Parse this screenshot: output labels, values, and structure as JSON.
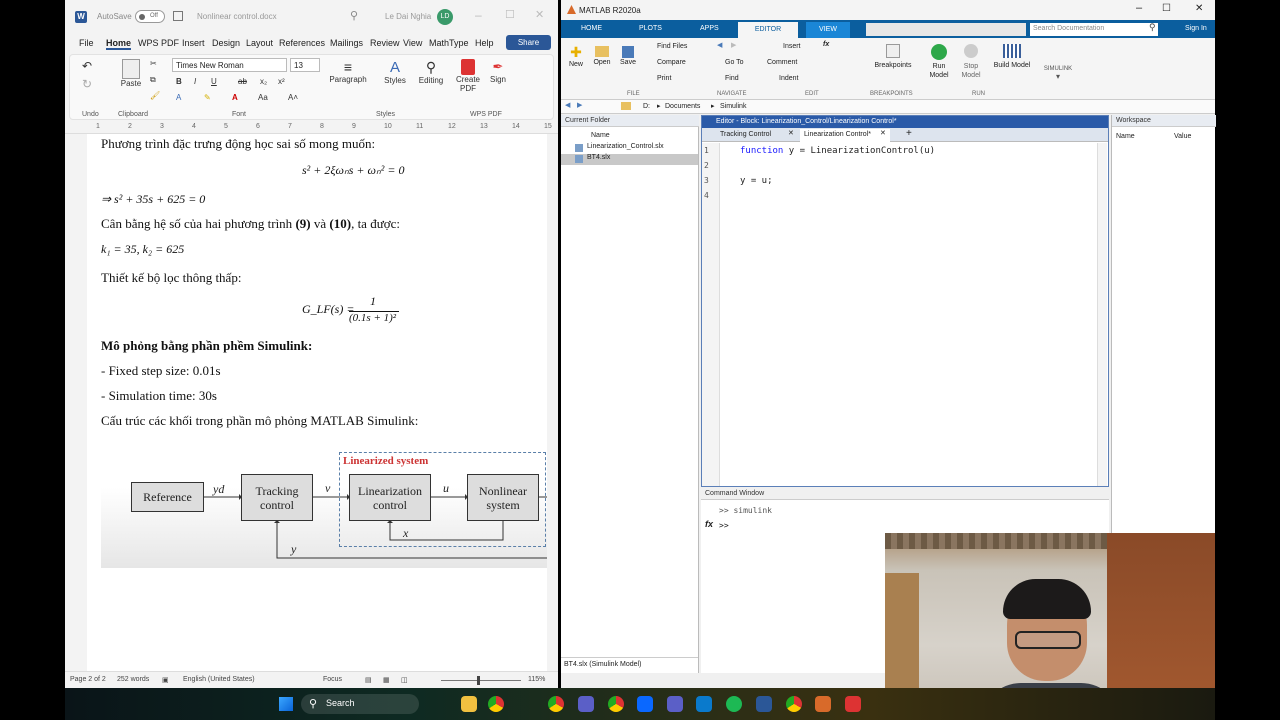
{
  "word": {
    "autosave_label": "AutoSave",
    "autosave_state": "Off",
    "doc_title": "Nonlinear control.docx",
    "user_name": "Le Dai Nghia",
    "user_initials": "LD",
    "tabs": [
      "File",
      "Home",
      "WPS PDF",
      "Insert",
      "Design",
      "Layout",
      "References",
      "Mailings",
      "Review",
      "View",
      "MathType",
      "Help"
    ],
    "share_label": "Share",
    "font_name": "Times New Roman",
    "font_size": "13",
    "groups": {
      "undo": "Undo",
      "clipboard": "Clipboard",
      "font": "Font",
      "styles": "Styles",
      "wps": "WPS PDF"
    },
    "buttons": {
      "paste": "Paste",
      "paragraph": "Paragraph",
      "styles": "Styles",
      "editing": "Editing",
      "create_pdf": "Create PDF",
      "sign": "Sign"
    },
    "ruler_numbers": [
      "1",
      "2",
      "3",
      "4",
      "5",
      "6",
      "7",
      "8",
      "9",
      "10",
      "11",
      "12",
      "13",
      "14",
      "15"
    ],
    "doc": {
      "line1": "Phương trình đặc trưng động học sai số mong muốn:",
      "eq1": "s² + 2ξωₙs + ωₙ² = 0",
      "eq2": "⇒ s² + 35s + 625 = 0",
      "line2_a": "Cân bằng hệ số của hai phương trình ",
      "line2_b": "(9)",
      "line2_c": " và ",
      "line2_d": "(10)",
      "line2_e": ", ta được:",
      "eq3": "k₁ = 35, k₂ = 625",
      "line3": "Thiết kế bộ lọc thông thấp:",
      "eq4_lhs": "G_LF(s) =",
      "eq4_num": "1",
      "eq4_den": "(0.1s + 1)²",
      "line4": "Mô phỏng bằng phần phềm Simulink:",
      "line5": "- Fixed step size: 0.01s",
      "line6": "- Simulation time: 30s",
      "line7": "Cấu trúc các khối trong phần mô phỏng MATLAB Simulink:"
    },
    "diagram": {
      "group_label": "Linearized system",
      "reference": "Reference",
      "yd": "yd",
      "tracking": "Tracking control",
      "v": "v",
      "lincontrol": "Linearization control",
      "u": "u",
      "nonlinear": "Nonlinear system",
      "x": "x",
      "y": "y"
    },
    "status": {
      "page": "Page 2 of 2",
      "words": "252 words",
      "lang": "English (United States)",
      "focus": "Focus",
      "zoom": "115%"
    }
  },
  "matlab": {
    "title": "MATLAB R2020a",
    "tabs": [
      "HOME",
      "PLOTS",
      "APPS",
      "EDITOR",
      "VIEW"
    ],
    "search_placeholder": "Search Documentation",
    "sign_in": "Sign In",
    "ribbon": {
      "new": "New",
      "open": "Open",
      "save": "Save",
      "find_files": "Find Files",
      "compare": "Compare",
      "print": "Print",
      "go_to": "Go To",
      "find": "Find",
      "insert": "Insert",
      "comment": "Comment",
      "indent": "Indent",
      "breakpoints": "Breakpoints",
      "run_model": "Run Model",
      "stop_model": "Stop Model",
      "build_model": "Build Model",
      "simulink": "SIMULINK",
      "sec_file": "FILE",
      "sec_nav": "NAVIGATE",
      "sec_edit": "EDIT",
      "sec_bp": "BREAKPOINTS",
      "sec_run": "RUN"
    },
    "path": [
      "D:",
      "Documents",
      "Simulink"
    ],
    "current_folder": {
      "title": "Current Folder",
      "col_name": "Name",
      "files": [
        "Linearization_Control.slx",
        "BT4.slx"
      ],
      "footer": "BT4.slx  (Simulink Model)"
    },
    "editor": {
      "title": "Editor - Block: Linearization_Control/Linearization Control*",
      "tabs": [
        "Tracking Control",
        "Linearization Control*"
      ],
      "lines": [
        "function y = LinearizationControl(u)",
        "",
        "y = u;",
        ""
      ],
      "line_numbers": [
        "1",
        "2",
        "3",
        "4"
      ]
    },
    "command": {
      "title": "Command Window",
      "line1": ">> simulink",
      "prompt": ">>"
    },
    "workspace": {
      "title": "Workspace",
      "col_name": "Name",
      "col_value": "Value"
    }
  },
  "taskbar": {
    "search": "Search"
  }
}
